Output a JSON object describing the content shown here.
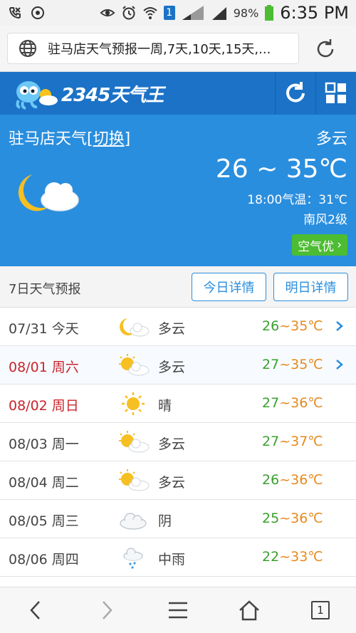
{
  "status_bar": {
    "battery_percent": "98%",
    "time": "6:35 PM",
    "sim_number": "1"
  },
  "browser": {
    "url_text": "驻马店天气预报一周,7天,10天,15天,..."
  },
  "app": {
    "logo_text": "2345天气王"
  },
  "current": {
    "city": "驻马店天气",
    "switch_label": "[切换]",
    "switch_text": "切换",
    "condition": "多云",
    "temp_range": "26 ~ 35℃",
    "temp_1800": "18:00气温：31℃",
    "wind": "南风2级",
    "aqi_label": "空气优",
    "aqi_chevron": "›"
  },
  "forecast": {
    "title": "7日天气预报",
    "today_btn": "今日详情",
    "tomorrow_btn": "明日详情",
    "rows": [
      {
        "date": "07/31 今天",
        "icon": "partly-cloudy-night-icon",
        "cond": "多云",
        "lo": "26",
        "hi": "35℃",
        "chev": true,
        "red": false
      },
      {
        "date": "08/01 周六",
        "icon": "partly-cloudy-day-icon",
        "cond": "多云",
        "lo": "27",
        "hi": "35℃",
        "chev": true,
        "red": true
      },
      {
        "date": "08/02 周日",
        "icon": "sunny-icon",
        "cond": "晴",
        "lo": "27",
        "hi": "36℃",
        "chev": false,
        "red": true
      },
      {
        "date": "08/03 周一",
        "icon": "partly-cloudy-day-icon",
        "cond": "多云",
        "lo": "27",
        "hi": "37℃",
        "chev": false,
        "red": false
      },
      {
        "date": "08/04 周二",
        "icon": "partly-cloudy-day-icon",
        "cond": "多云",
        "lo": "26",
        "hi": "36℃",
        "chev": false,
        "red": false
      },
      {
        "date": "08/05 周三",
        "icon": "overcast-icon",
        "cond": "阴",
        "lo": "25",
        "hi": "36℃",
        "chev": false,
        "red": false
      },
      {
        "date": "08/06 周四",
        "icon": "moderate-rain-icon",
        "cond": "中雨",
        "lo": "22",
        "hi": "33℃",
        "chev": false,
        "red": false
      }
    ]
  },
  "bottom_nav": {
    "tab_count": "1"
  },
  "colors": {
    "app_blue": "#1b72c6",
    "panel_blue": "#2a8ede",
    "aqi_green": "#4cbc32",
    "temp_low_green": "#3aa02f",
    "temp_high_orange": "#e68a1e",
    "weekend_red": "#c9242b"
  }
}
